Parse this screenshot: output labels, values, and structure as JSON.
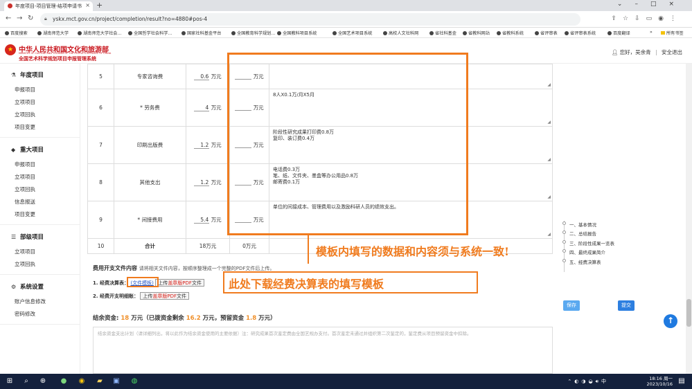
{
  "browser": {
    "tab_title": "年度项目-项目管理-结项申请书",
    "url": "yskx.mct.gov.cn/project/completion/result?no=4880#pos-4",
    "bookmarks": [
      "百度搜索",
      "湖南师范大学",
      "湖南师范大学社会...",
      "全国哲学社会科学...",
      "国家社科基金平台",
      "全国教育科学规划...",
      "全国教科项目系统",
      "全国艺术项目系统",
      "高校人文社科网",
      "省社科基金",
      "省教科网站",
      "省教科系统",
      "省评审表",
      "省评审表系统",
      "百度翻译"
    ],
    "bookmarks_overflow": "»",
    "all_bookmarks": "所有书签"
  },
  "site": {
    "org_name": "中华人民共和国文化和旅游部",
    "org_name_en": "MINISTRY OF CULTURE AND TOURISM OF THE PEOPLE'S REPUBLIC OF CHINA",
    "system_name": "全国艺术科学规划项目申报管理系统",
    "greeting": "您好，吴余青",
    "logout": "安全退出"
  },
  "sidebar": {
    "sections": [
      {
        "title": "年度项目",
        "icon": "flask-icon",
        "items": [
          "申报项目",
          "立项项目",
          "立项回执",
          "项目变更"
        ]
      },
      {
        "title": "重大项目",
        "icon": "tag-icon",
        "items": [
          "申报项目",
          "立项项目",
          "立项回执",
          "信息报送",
          "项目变更"
        ]
      },
      {
        "title": "部级项目",
        "icon": "list-icon",
        "items": [
          "立项项目",
          "立项回执"
        ]
      },
      {
        "title": "系统设置",
        "icon": "gears-icon",
        "items": [
          "账户信息修改",
          "密码修改"
        ]
      }
    ]
  },
  "budget_rows": [
    {
      "no": "5",
      "name": "专家咨询费",
      "required": false,
      "amount": "0.6",
      "unit": "万元",
      "final_unit": "万元",
      "desc": []
    },
    {
      "no": "6",
      "name": "劳务费",
      "required": true,
      "amount": "4",
      "unit": "万元",
      "final_unit": "万元",
      "desc": [
        "8人X0.1万/月X5月"
      ]
    },
    {
      "no": "7",
      "name": "印刷出版费",
      "required": false,
      "amount": "1.2",
      "unit": "万元",
      "final_unit": "万元",
      "desc": [
        "阶段性研究成果打印费0.8万",
        "复印、装订费0.4万"
      ]
    },
    {
      "no": "8",
      "name": "其他支出",
      "required": false,
      "amount": "1.2",
      "unit": "万元",
      "final_unit": "万元",
      "desc": [
        "电话费0.3万",
        "笔、纸、文件夹、墨盒等办公用品0.8万",
        "邮寄费0.1万"
      ]
    },
    {
      "no": "9",
      "name": "间接费用",
      "required": true,
      "amount": "5.4",
      "unit": "万元",
      "final_unit": "万元",
      "desc": [
        "单位的间接成本、管理费用以及激励科研人员的绩效支出。"
      ]
    }
  ],
  "total_row": {
    "no": "10",
    "name": "合计",
    "amount": "18万元",
    "final": "0万元"
  },
  "required_mark": "*",
  "fees": {
    "title": "费用开支文件内容",
    "hint": "请将相关文件内容，按顺序整理成一个完整的PDF文件后上传。",
    "row1_label": "1. 经费决算表：",
    "template_link": "(文件模板)",
    "upload_prefix": "上传",
    "upload_red": "盖章版PDF",
    "upload_suffix": "文件",
    "row2_label": "2. 经费开支明细账："
  },
  "balance": {
    "label": "结余资金:",
    "total": "18",
    "unit": "万元",
    "mid_label": "（已拨资金剩余",
    "remaining": "16.2",
    "mid_unit": "万元，预留资金",
    "reserve": "1.8",
    "end": "万元）"
  },
  "balance_placeholder": "结余资金支出计划（请详细列出，将以此作为结余资金使用的主要依据）注：研究成果首次鉴定费由全国艺规办支付。首次鉴定未通过并组织第二次鉴定的，鉴定费从项目预留资金中扣除。",
  "steps": [
    "基本情况",
    "总结报告",
    "阶段性成果一览表",
    "最终成果简介",
    "经费决算表"
  ],
  "step_prefixes": [
    "一",
    "二",
    "三",
    "四",
    "五"
  ],
  "buttons": {
    "save": "保存",
    "submit": "提交",
    "back_to_top": "↑"
  },
  "annotations": {
    "main": "模板内填写的数据和内容须与系统一致!",
    "download": "此处下载经费决算表的填写模板",
    "color": "#f07b1e"
  },
  "taskbar": {
    "time": "18:16 周一",
    "date": "2023/10/16",
    "ime": "中"
  }
}
